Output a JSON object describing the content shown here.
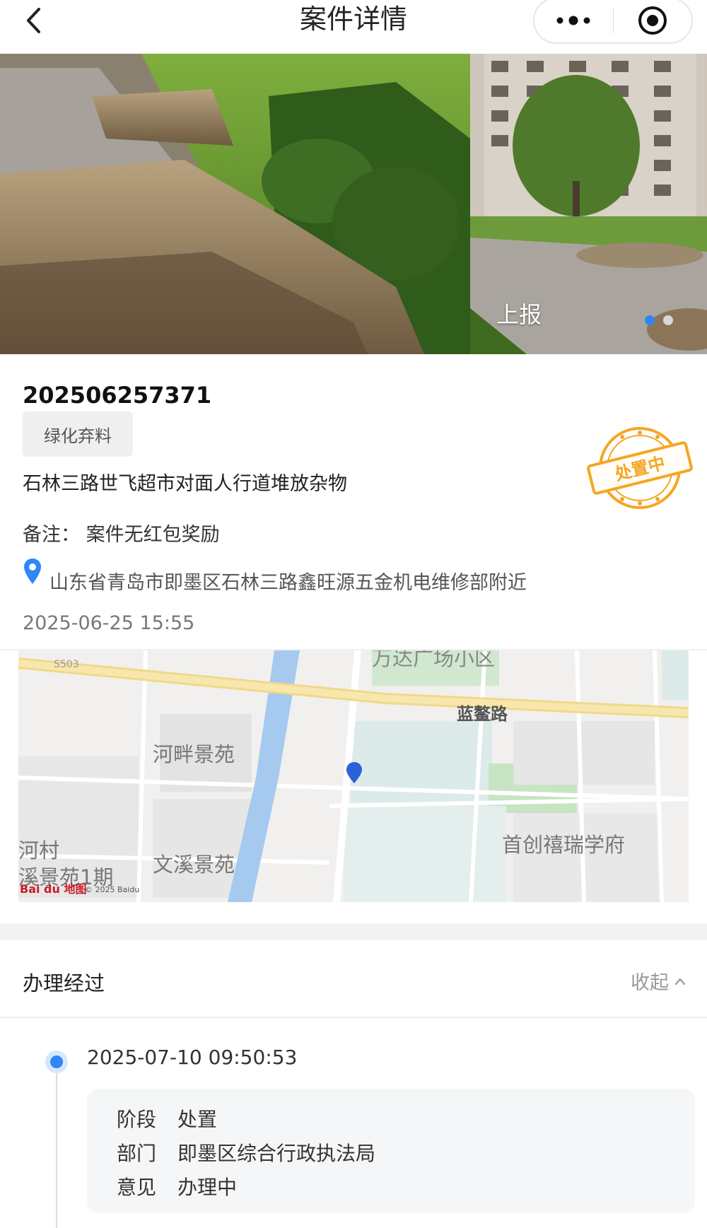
{
  "header": {
    "title": "案件详情",
    "back_icon": "chevron-left-icon",
    "more_icon": "more-dots-icon",
    "close_icon": "target-close-icon"
  },
  "carousel": {
    "label": "上报",
    "image_count": 2,
    "active_index": 0,
    "active_color": "#2f86f6"
  },
  "case": {
    "number": "202506257371",
    "tag": "绿化弃料",
    "title": "石林三路世飞超市对面人行道堆放杂物",
    "remark": "备注： 案件无红包奖励",
    "address": "山东省青岛市即墨区石林三路鑫旺源五金机电维修部附近",
    "time": "2025-06-25 15:55",
    "status_stamp": "处置中",
    "stamp_color": "#f5a623"
  },
  "map": {
    "labels": {
      "hepan": "河畔景苑",
      "wenxi": "文溪景苑",
      "shouchuang": "首创禧瑞学府",
      "hecun": "河村",
      "xijingyuan": "溪景苑1期",
      "road": "蓝鳌路",
      "road_code": "S503",
      "top": "万达广场小区"
    },
    "logo": "Bai du 地图",
    "copyright": "© 2025 Baidu",
    "marker_color": "#2b62d9"
  },
  "process": {
    "title": "办理经过",
    "collapse_label": "收起",
    "entries": [
      {
        "time": "2025-07-10 09:50:53",
        "stage_key": "阶段",
        "stage": "处置",
        "dept_key": "部门",
        "dept": "即墨区综合行政执法局",
        "opinion_key": "意见",
        "opinion": "办理中"
      }
    ]
  }
}
